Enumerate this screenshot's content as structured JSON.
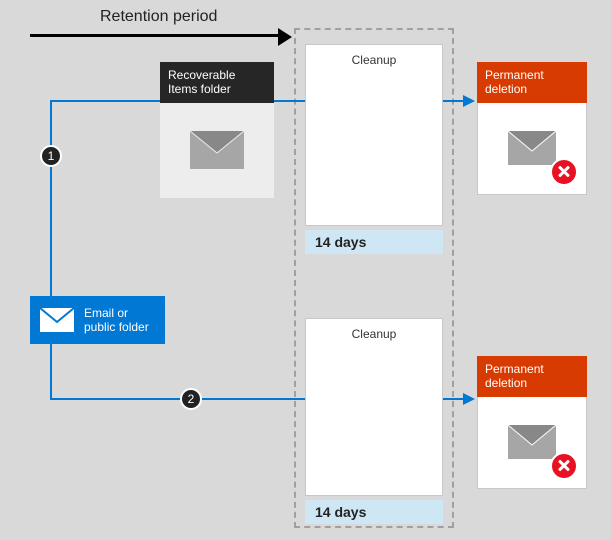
{
  "retention": {
    "label": "Retention period"
  },
  "source": {
    "label": "Email or public folder"
  },
  "recoverable": {
    "header": "Recoverable Items folder"
  },
  "cleanup": {
    "label_top": "Cleanup",
    "label_bottom": "Cleanup",
    "days_top": "14 days",
    "days_bottom": "14 days"
  },
  "permanent": {
    "header_top": "Permanent deletion",
    "header_bottom": "Permanent deletion"
  },
  "steps": {
    "one": "1",
    "two": "2"
  }
}
